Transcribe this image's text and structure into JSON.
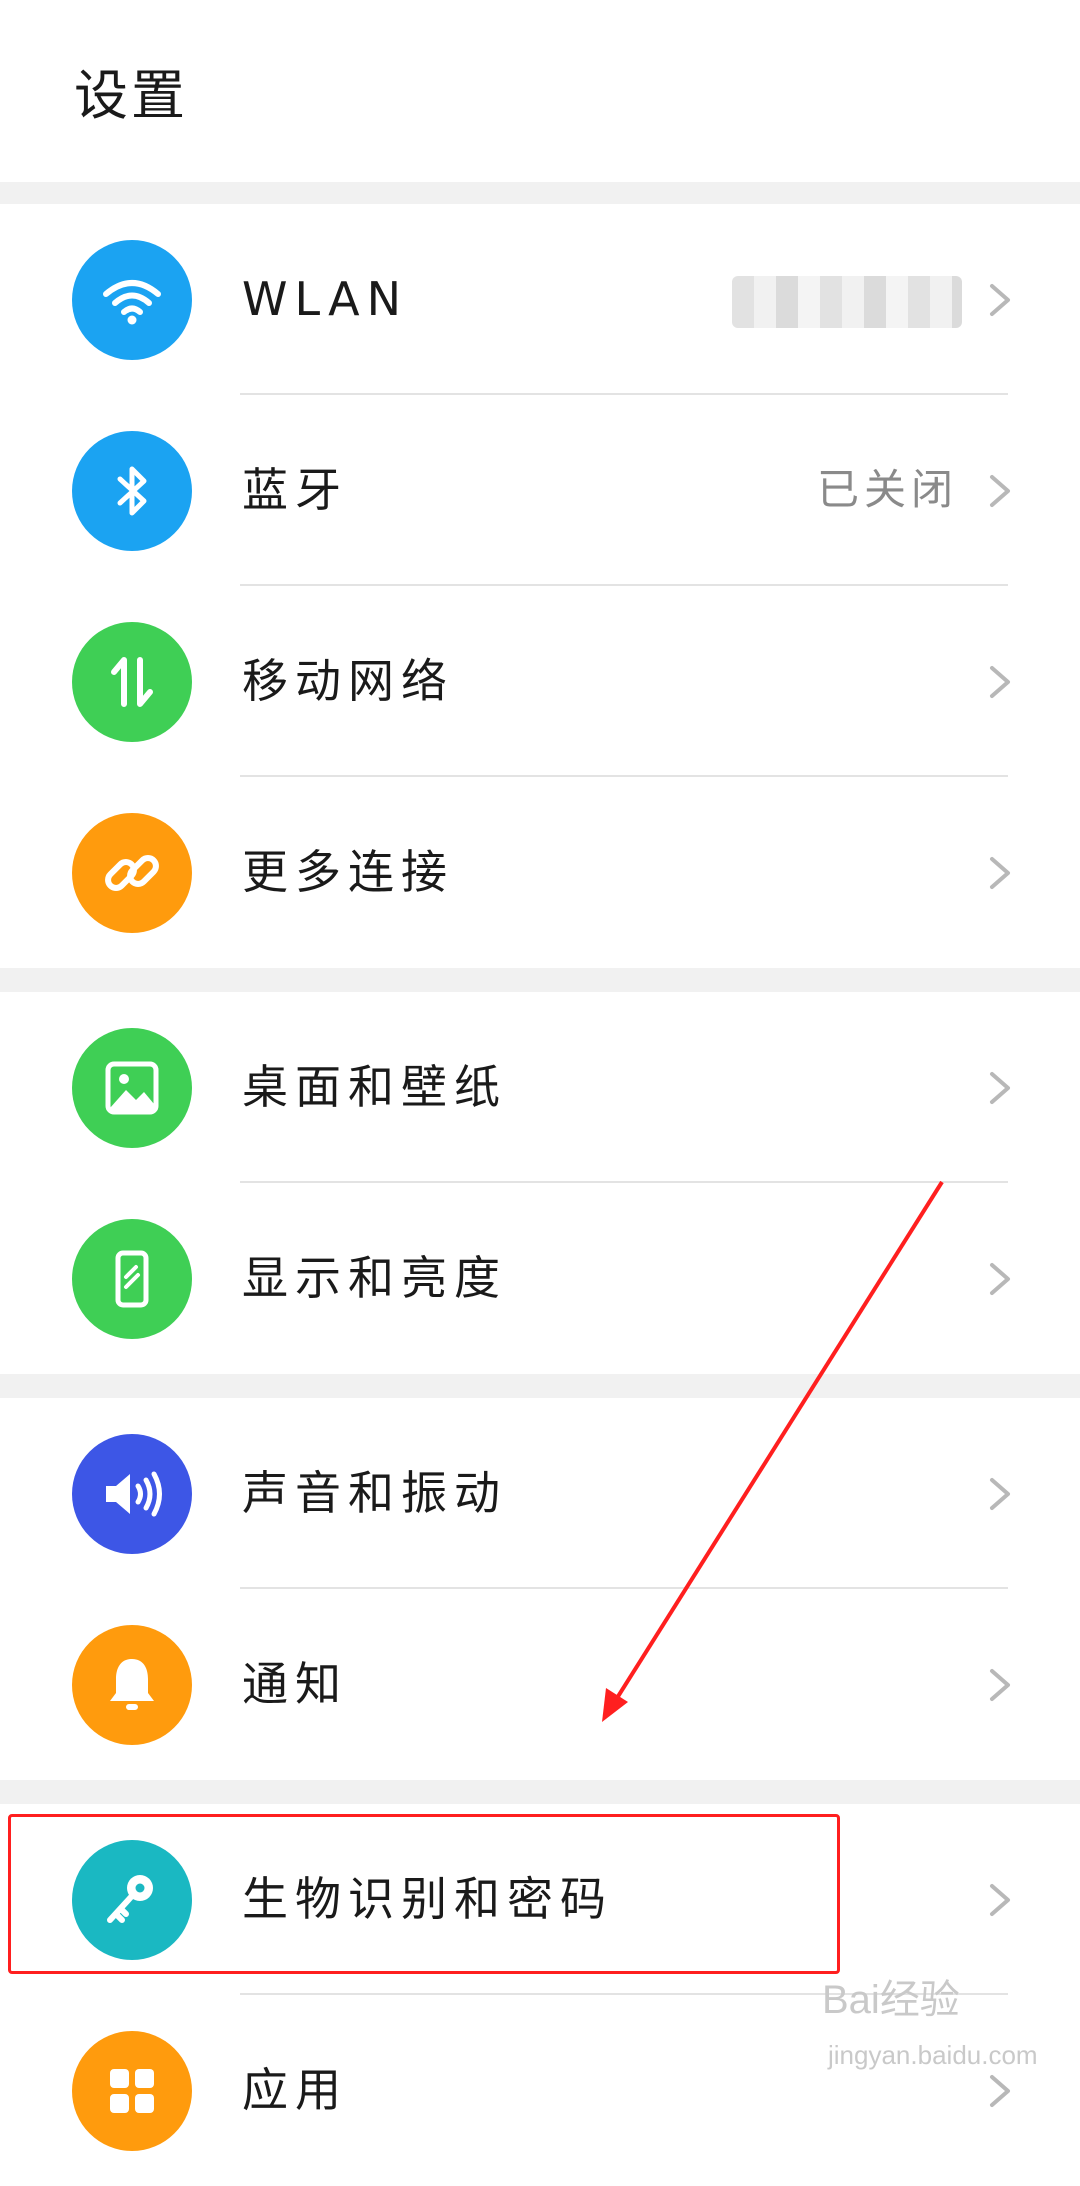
{
  "header": {
    "title": "设置"
  },
  "items": [
    {
      "label": "WLAN",
      "value": "",
      "icon": "wifi-icon",
      "color": "#1ba3f2"
    },
    {
      "label": "蓝牙",
      "value": "已关闭",
      "icon": "bluetooth-icon",
      "color": "#1ba3f2"
    },
    {
      "label": "移动网络",
      "value": "",
      "icon": "mobile-data-icon",
      "color": "#3fcf55"
    },
    {
      "label": "更多连接",
      "value": "",
      "icon": "link-icon",
      "color": "#ff9b0d"
    },
    {
      "label": "桌面和壁纸",
      "value": "",
      "icon": "image-icon",
      "color": "#3fcf55"
    },
    {
      "label": "显示和亮度",
      "value": "",
      "icon": "display-icon",
      "color": "#3fcf55"
    },
    {
      "label": "声音和振动",
      "value": "",
      "icon": "sound-icon",
      "color": "#3d56e6"
    },
    {
      "label": "通知",
      "value": "",
      "icon": "bell-icon",
      "color": "#ff9b0d"
    },
    {
      "label": "生物识别和密码",
      "value": "",
      "icon": "key-icon",
      "color": "#1ab8c2"
    },
    {
      "label": "应用",
      "value": "",
      "icon": "apps-icon",
      "color": "#ff9b0d"
    }
  ],
  "annotation": {
    "highlight_color": "#ff1f1f"
  },
  "watermark": {
    "brand": "Bai经验",
    "url": "jingyan.baidu.com"
  }
}
